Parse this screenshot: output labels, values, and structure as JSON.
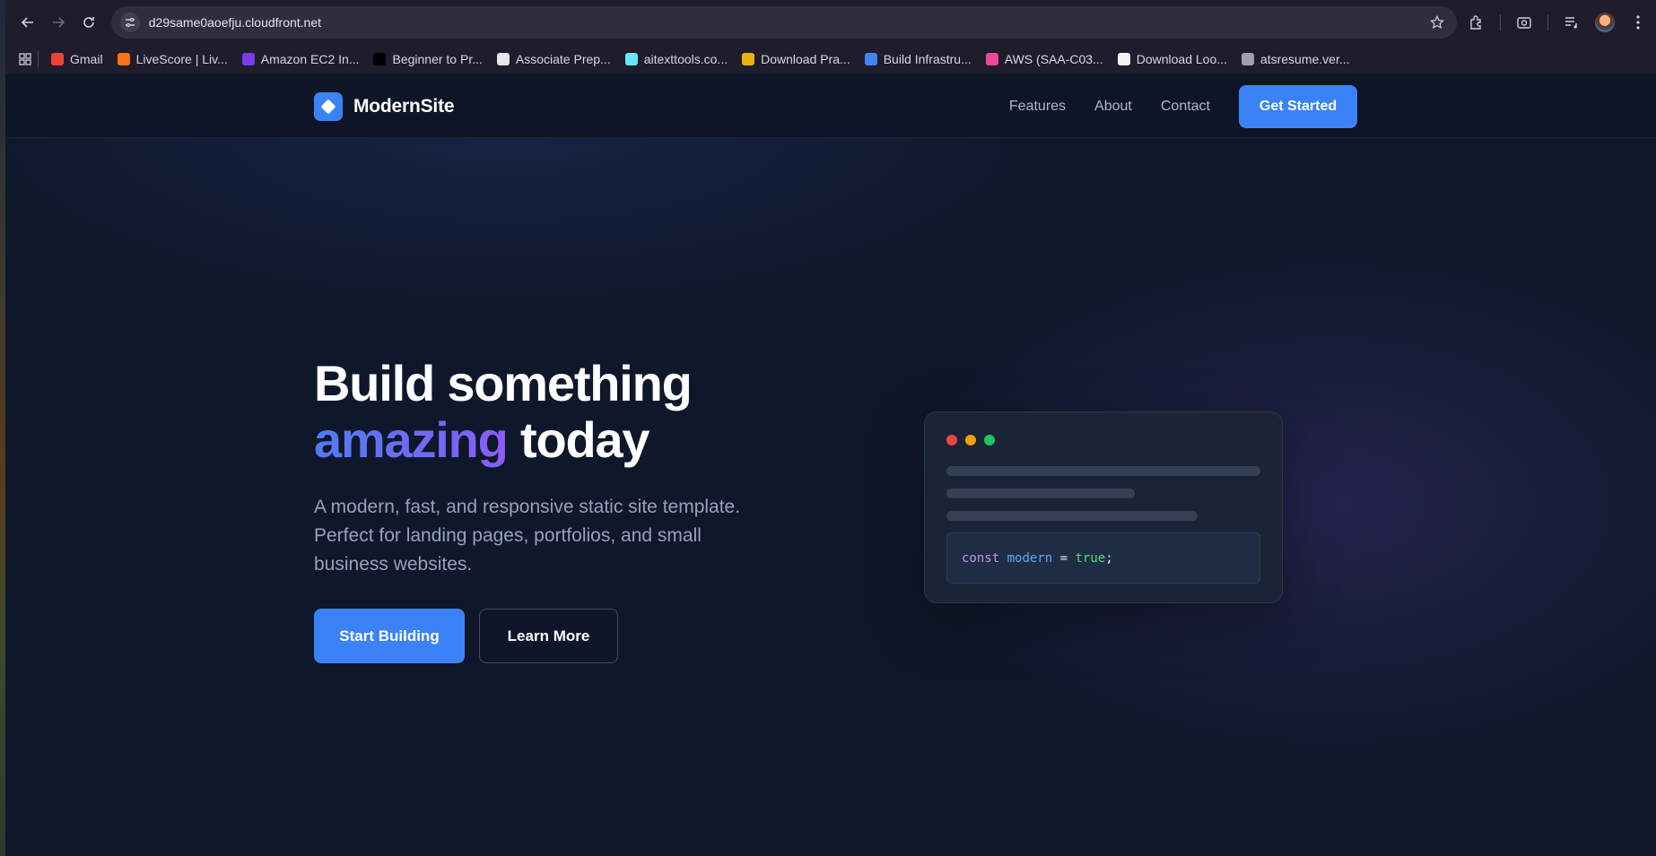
{
  "browser": {
    "url": "d29same0aoefju.cloudfront.net",
    "bookmarks": [
      {
        "label": "Gmail",
        "color": "#ea4335"
      },
      {
        "label": "LiveScore | Liv...",
        "color": "#f97316"
      },
      {
        "label": "Amazon EC2 In...",
        "color": "#7c3aed"
      },
      {
        "label": "Beginner to Pr...",
        "color": "#000000"
      },
      {
        "label": "Associate Prep...",
        "color": "#e5e7eb"
      },
      {
        "label": "aitexttools.co...",
        "color": "#67e8f9"
      },
      {
        "label": "Download Pra...",
        "color": "#eab308"
      },
      {
        "label": "Build Infrastru...",
        "color": "#4285f4"
      },
      {
        "label": "AWS (SAA-C03...",
        "color": "#ec4899"
      },
      {
        "label": "Download Loo...",
        "color": "#f3f4f6"
      },
      {
        "label": "atsresume.ver...",
        "color": "#9ca3af"
      }
    ]
  },
  "site": {
    "brand": "ModernSite",
    "nav": [
      "Features",
      "About",
      "Contact"
    ],
    "cta": "Get Started",
    "hero": {
      "title_line1": "Build something",
      "title_highlight": "amazing",
      "title_rest": "today",
      "subtitle": "A modern, fast, and responsive static site template. Perfect for landing pages, portfolios, and small business websites.",
      "primary_button": "Start Building",
      "secondary_button": "Learn More"
    },
    "code": {
      "keyword": "const",
      "name": "modern",
      "operator": "=",
      "value": "true",
      "terminator": ";"
    }
  },
  "colors": {
    "accent": "#3b82f6",
    "gradient_start": "#4f7cf0",
    "gradient_end": "#8b5cf6",
    "dot_red": "#ef4444",
    "dot_yellow": "#f59e0b",
    "dot_green": "#22c55e"
  }
}
